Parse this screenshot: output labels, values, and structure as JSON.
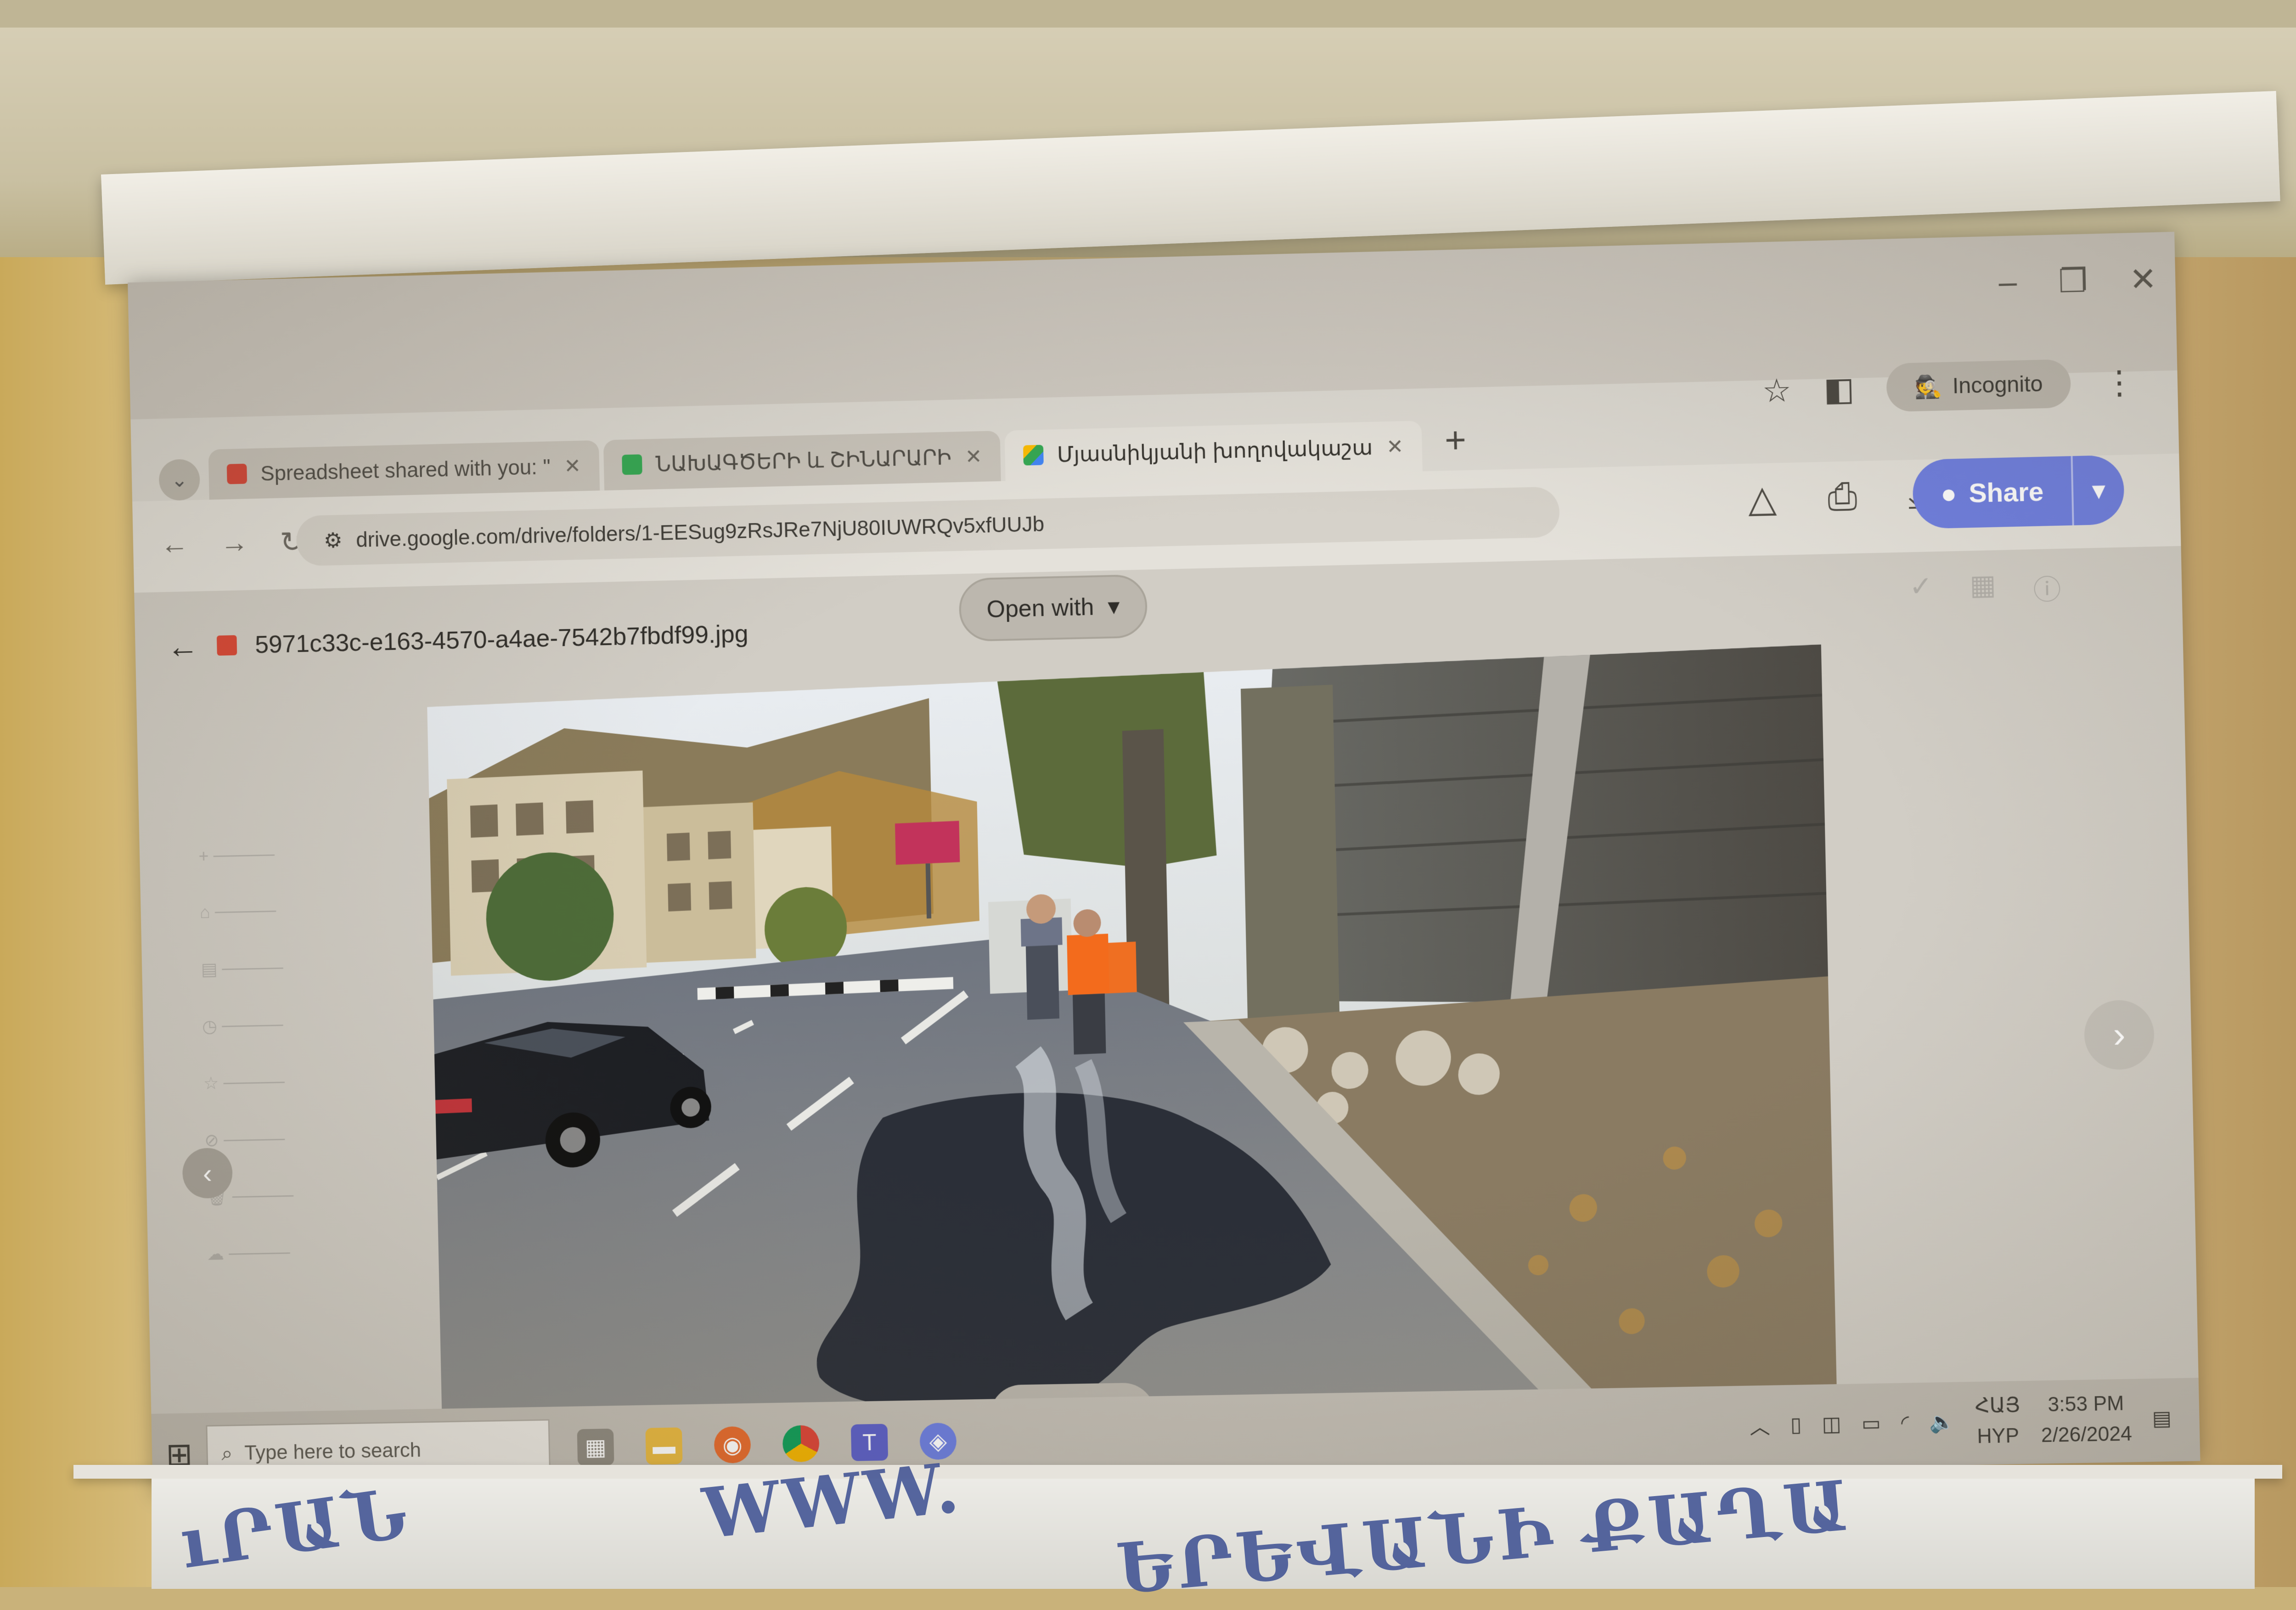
{
  "window": {
    "controls": [
      "–",
      "❐",
      "✕"
    ]
  },
  "tabs": [
    {
      "label": "Spreadsheet shared with you: \"",
      "favicon_color": "#d44638",
      "active": false
    },
    {
      "label": "ՆԱԽԱԳԾԵՐԻ և ՇԻՆԱՐԱՐԻ",
      "favicon_color": "#34a853",
      "active": false
    },
    {
      "label": "Մյասնիկյանի խողովակաշա",
      "favicon_color": "#4285f4",
      "active": true
    }
  ],
  "browser": {
    "incognito_label": "Incognito",
    "url": "drive.google.com/drive/folders/1-EESug9zRsJRe7NjU80IUWRQv5xfUUJb"
  },
  "drive": {
    "share_label": "Share",
    "open_with_label": "Open with",
    "file_name": "5971c33c-e163-4570-a4ae-7542b7fbdf99.jpg"
  },
  "taskbar": {
    "search_placeholder": "Type here to search",
    "lang_top": "ՀԱՅ",
    "lang_bottom": "HYP",
    "time": "3:53 PM",
    "date": "2/26/2024"
  },
  "colors": {
    "share_button": "#6f7fe0",
    "pdf_icon": "#d94735",
    "asphalt": "#2b2f38",
    "vest": "#f36b1c"
  }
}
